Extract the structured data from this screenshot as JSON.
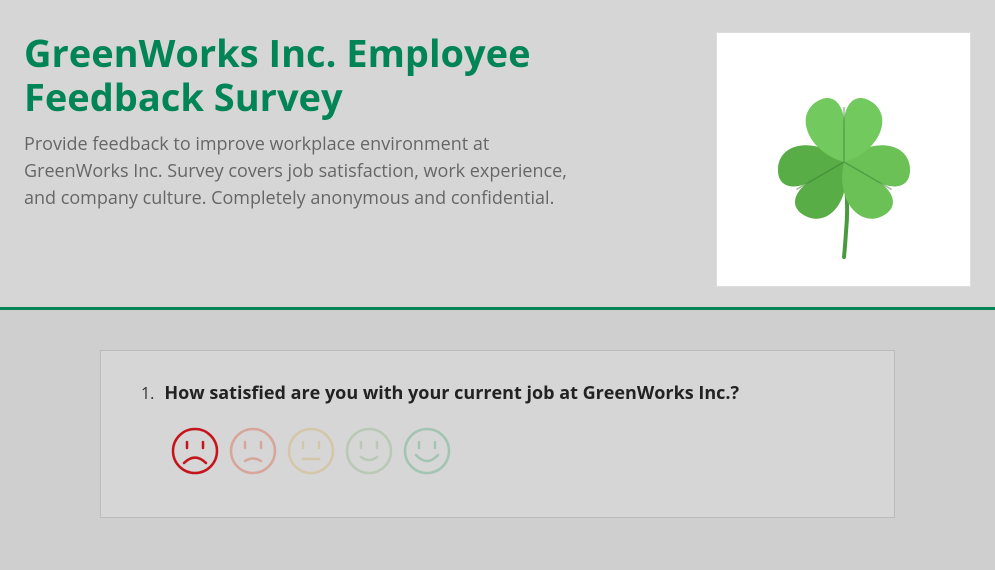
{
  "header": {
    "title": "GreenWorks Inc. Employee Feedback Survey",
    "description": "Provide feedback to improve workplace environment at GreenWorks Inc. Survey covers job satisfaction, work experience, and company culture. Completely anonymous and confidential.",
    "logo_icon": "three-leaf-clover"
  },
  "question": {
    "number": "1.",
    "text": "How satisfied are you with your current job at GreenWorks Inc.?",
    "rating_options": [
      {
        "level": 1,
        "mood": "very-dissatisfied",
        "color": "#c4151c"
      },
      {
        "level": 2,
        "mood": "dissatisfied",
        "color": "#d7a59a"
      },
      {
        "level": 3,
        "mood": "neutral",
        "color": "#d4c6a8"
      },
      {
        "level": 4,
        "mood": "satisfied",
        "color": "#b9c9b5"
      },
      {
        "level": 5,
        "mood": "very-satisfied",
        "color": "#a3c4b3"
      }
    ]
  }
}
